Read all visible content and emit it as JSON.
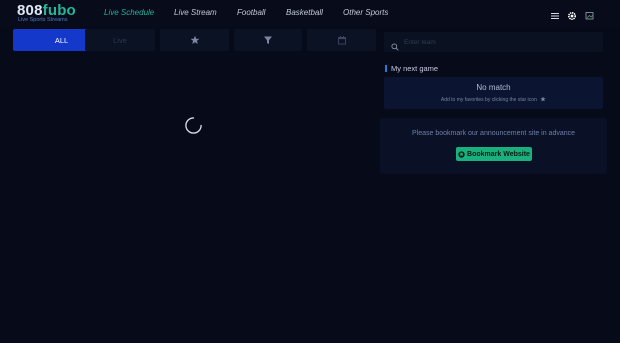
{
  "brand": {
    "logo_main_a": "808",
    "logo_main_b": "fubo",
    "logo_sub": "Live Sports Streams"
  },
  "nav": {
    "items": [
      {
        "label": "Live Schedule",
        "active": true
      },
      {
        "label": "Live Stream",
        "active": false
      },
      {
        "label": "Football",
        "active": false
      },
      {
        "label": "Basketball",
        "active": false
      },
      {
        "label": "Other Sports",
        "active": false
      }
    ]
  },
  "header_icons": [
    "menu-icon",
    "settings-gear-icon",
    "flag-icon"
  ],
  "filters": {
    "all_label": "ALL",
    "live_label": "Live",
    "icons": [
      "star-icon",
      "filter-icon",
      "calendar-icon"
    ]
  },
  "search": {
    "placeholder": "Enter team"
  },
  "next_game": {
    "title": "My next game",
    "empty_text": "No match",
    "hint": "Add to my favorites by clicking the star icon"
  },
  "announcement": {
    "text": "Please bookmark our announcement site in advance",
    "button_label": "Bookmark Website"
  },
  "colors": {
    "background": "#060a19",
    "accent_green": "#1fb09a",
    "active_blue": "#1438c9",
    "bookmark_green": "#19b07e"
  }
}
